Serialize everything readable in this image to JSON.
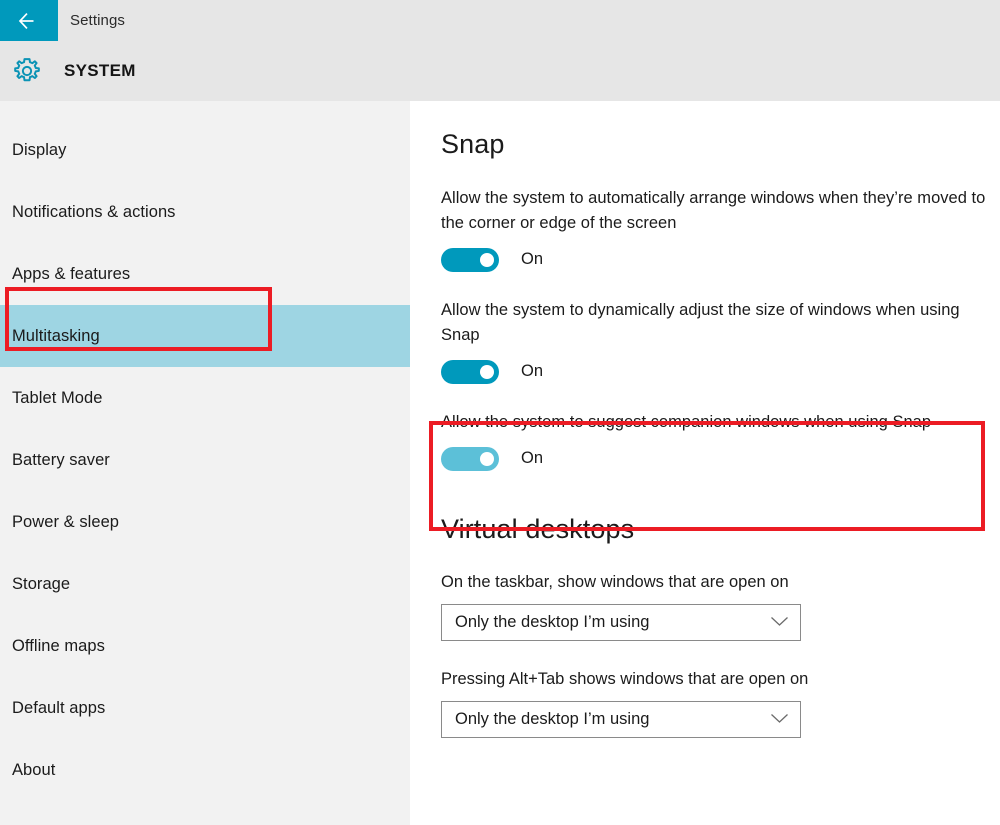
{
  "titlebar": {
    "back_icon": "back-arrow-icon",
    "title": "Settings"
  },
  "page_header": {
    "icon": "gear-icon",
    "title": "SYSTEM"
  },
  "sidebar": {
    "items": [
      {
        "label": "Display",
        "selected": false
      },
      {
        "label": "Notifications & actions",
        "selected": false
      },
      {
        "label": "Apps & features",
        "selected": false
      },
      {
        "label": "Multitasking",
        "selected": true
      },
      {
        "label": "Tablet Mode",
        "selected": false
      },
      {
        "label": "Battery saver",
        "selected": false
      },
      {
        "label": "Power & sleep",
        "selected": false
      },
      {
        "label": "Storage",
        "selected": false
      },
      {
        "label": "Offline maps",
        "selected": false
      },
      {
        "label": "Default apps",
        "selected": false
      },
      {
        "label": "About",
        "selected": false
      }
    ]
  },
  "main": {
    "snap": {
      "heading": "Snap",
      "settings": [
        {
          "label": "Allow the system to automatically arrange windows when they’re moved to the corner or edge of the screen",
          "toggle_state": "On",
          "toggle_on": true,
          "highlighted": false
        },
        {
          "label": "Allow the system to dynamically adjust the size of windows when using Snap",
          "toggle_state": "On",
          "toggle_on": true,
          "highlighted": false
        },
        {
          "label": "Allow the system to suggest companion windows when using Snap",
          "toggle_state": "On",
          "toggle_on": true,
          "highlighted": true
        }
      ]
    },
    "virtual_desktops": {
      "heading": "Virtual desktops",
      "fields": [
        {
          "label": "On the taskbar, show windows that are open on",
          "value": "Only the desktop I’m using",
          "chevron_icon": "chevron-down-icon"
        },
        {
          "label": "Pressing Alt+Tab shows windows that are open on",
          "value": "Only the desktop I’m using",
          "chevron_icon": "chevron-down-icon"
        }
      ]
    }
  },
  "colors": {
    "accent": "#0099bc",
    "accent_light": "#5cc0d8",
    "selection": "#9ed5e3",
    "annotation": "#ec1c24",
    "header_bg": "#e6e6e6",
    "sidebar_bg": "#f2f2f2"
  }
}
